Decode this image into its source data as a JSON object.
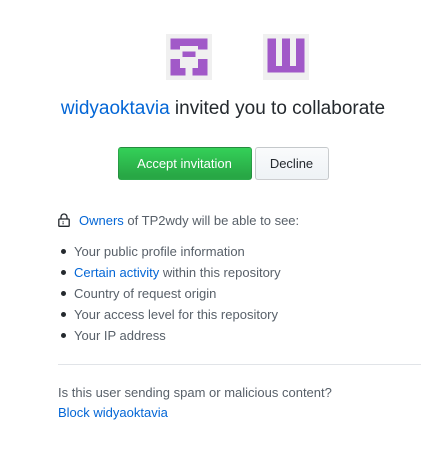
{
  "invite": {
    "inviter": "widyaoktavia",
    "headline_rest": " invited you to collaborate",
    "accept_label": "Accept invitation",
    "decline_label": "Decline"
  },
  "permissions": {
    "owners_link": "Owners",
    "owners_rest": " of TP2wdy will be able to see:",
    "items": [
      {
        "text": "Your public profile information"
      },
      {
        "link": "Certain activity",
        "text": " within this repository"
      },
      {
        "text": "Country of request origin"
      },
      {
        "text": "Your access level for this repository"
      },
      {
        "text": "Your IP address"
      }
    ]
  },
  "spam": {
    "question": "Is this user sending spam or malicious content?",
    "block_label": "Block widyaoktavia"
  },
  "colors": {
    "identicon": "#a159c8",
    "link": "#0366d6",
    "accept_green": "#28a745"
  },
  "icons": {
    "inviter_avatar": "identicon-avatar",
    "invitee_avatar": "identicon-avatar",
    "lock": "lock-icon"
  }
}
